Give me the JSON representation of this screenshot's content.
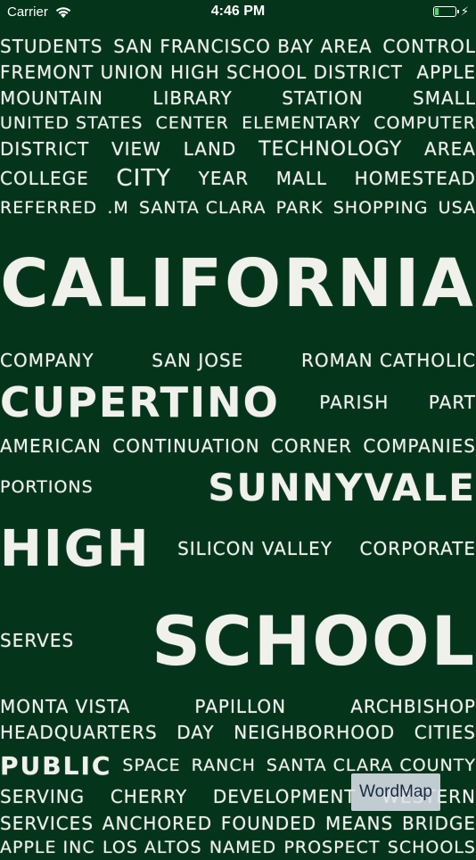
{
  "status": {
    "carrier": "Carrier",
    "time": "4:46 PM",
    "battery_level": 0.2,
    "battery_color": "#4cd964"
  },
  "background_color": "#04341a",
  "words": {
    "r1": [
      "STUDENTS",
      "SAN FRANCISCO BAY AREA",
      "CONTROL"
    ],
    "r2": [
      "FREMONT UNION HIGH SCHOOL DISTRICT",
      "APPLE"
    ],
    "r3": [
      "MOUNTAIN",
      "LIBRARY",
      "STATION",
      "SMALL"
    ],
    "r4": [
      "UNITED STATES",
      "CENTER",
      "ELEMENTARY",
      "COMPUTER"
    ],
    "r5": [
      "DISTRICT",
      "VIEW",
      "LAND",
      "TECHNOLOGY",
      "AREA"
    ],
    "r6": [
      "COLLEGE",
      "CITY",
      "YEAR",
      "MALL",
      "HOMESTEAD"
    ],
    "r7": [
      "REFERRED",
      ".M",
      "SANTA CLARA",
      "PARK",
      "SHOPPING",
      "USA"
    ],
    "r8": [
      "CALIFORNIA"
    ],
    "r9": [
      "COMPANY",
      "SAN JOSE",
      "ROMAN CATHOLIC"
    ],
    "r10": [
      "CUPERTINO",
      "PARISH",
      "PART"
    ],
    "r11": [
      "AMERICAN",
      "CONTINUATION",
      "CORNER",
      "COMPANIES"
    ],
    "r12": [
      "PORTIONS",
      "SUNNYVALE"
    ],
    "r13": [
      "HIGH",
      "SILICON VALLEY",
      "CORPORATE"
    ],
    "r14": [
      "SERVES",
      "SCHOOL"
    ],
    "r15": [
      "MONTA VISTA",
      "PAPILLON",
      "ARCHBISHOP"
    ],
    "r16": [
      "HEADQUARTERS",
      "DAY",
      "NEIGHBORHOOD",
      "CITIES"
    ],
    "r17": [
      "PUBLIC",
      "SPACE",
      "RANCH",
      "SANTA CLARA COUNTY"
    ],
    "r18": [
      "SERVING",
      "CHERRY",
      "DEVELOPMENT",
      "WESTERN"
    ],
    "r19": [
      "SERVICES",
      "ANCHORED",
      "FOUNDED",
      "MEANS",
      "BRIDGE"
    ],
    "r20": [
      "APPLE INC",
      "LOS ALTOS",
      "NAMED",
      "PROSPECT",
      "SCHOOLS"
    ]
  },
  "badge": {
    "label": "WordMap"
  }
}
